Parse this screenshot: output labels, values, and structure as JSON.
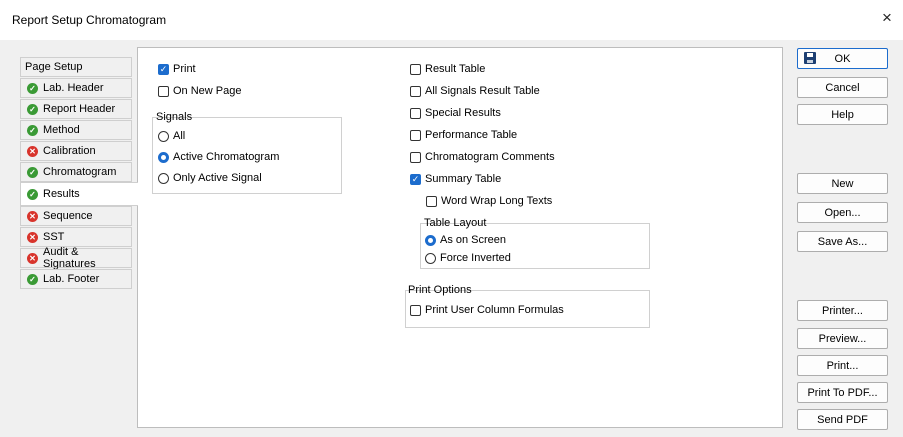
{
  "window": {
    "title": "Report Setup Chromatogram",
    "close_glyph": "×"
  },
  "sidebar": {
    "header": "Page Setup",
    "items": [
      {
        "label": "Lab. Header",
        "status": "ok"
      },
      {
        "label": "Report Header",
        "status": "ok"
      },
      {
        "label": "Method",
        "status": "ok"
      },
      {
        "label": "Calibration",
        "status": "error"
      },
      {
        "label": "Chromatogram",
        "status": "ok"
      },
      {
        "label": "Results",
        "status": "ok",
        "selected": true
      },
      {
        "label": "Sequence",
        "status": "error"
      },
      {
        "label": "SST",
        "status": "error"
      },
      {
        "label": "Audit & Signatures",
        "status": "error"
      },
      {
        "label": "Lab. Footer",
        "status": "ok"
      }
    ]
  },
  "options": {
    "print": {
      "label": "Print",
      "checked": true
    },
    "on_new_page": {
      "label": "On New Page",
      "checked": false
    },
    "signals": {
      "label": "Signals",
      "all": {
        "label": "All",
        "checked": false
      },
      "active_chromatogram": {
        "label": "Active Chromatogram",
        "checked": true
      },
      "only_active_signal": {
        "label": "Only Active Signal",
        "checked": false
      }
    },
    "result_table": {
      "label": "Result Table",
      "checked": false
    },
    "all_signals_result_table": {
      "label": "All Signals Result Table",
      "checked": false
    },
    "special_results": {
      "label": "Special Results",
      "checked": false
    },
    "performance_table": {
      "label": "Performance Table",
      "checked": false
    },
    "chromatogram_comments": {
      "label": "Chromatogram Comments",
      "checked": false
    },
    "summary_table": {
      "label": "Summary Table",
      "checked": true
    },
    "word_wrap": {
      "label": "Word Wrap Long Texts",
      "checked": false
    },
    "table_layout": {
      "label": "Table Layout",
      "as_on_screen": {
        "label": "As on Screen",
        "checked": true
      },
      "force_inverted": {
        "label": "Force Inverted",
        "checked": false
      }
    },
    "print_options": {
      "label": "Print Options",
      "print_user_column_formulas": {
        "label": "Print User Column Formulas",
        "checked": false
      }
    }
  },
  "buttons": {
    "ok": "OK",
    "cancel": "Cancel",
    "help": "Help",
    "new": "New",
    "open": "Open...",
    "save_as": "Save As...",
    "printer": "Printer...",
    "preview": "Preview...",
    "print": "Print...",
    "print_to_pdf": "Print To PDF...",
    "send_pdf": "Send PDF"
  },
  "colors": {
    "accent": "#1c6ccd",
    "ok_status": "#3a9a35",
    "error_status": "#d8342c"
  },
  "icons": {
    "ok_status": "check-circle-icon",
    "error_status": "x-circle-icon",
    "ok_button": "floppy-disk-icon"
  }
}
